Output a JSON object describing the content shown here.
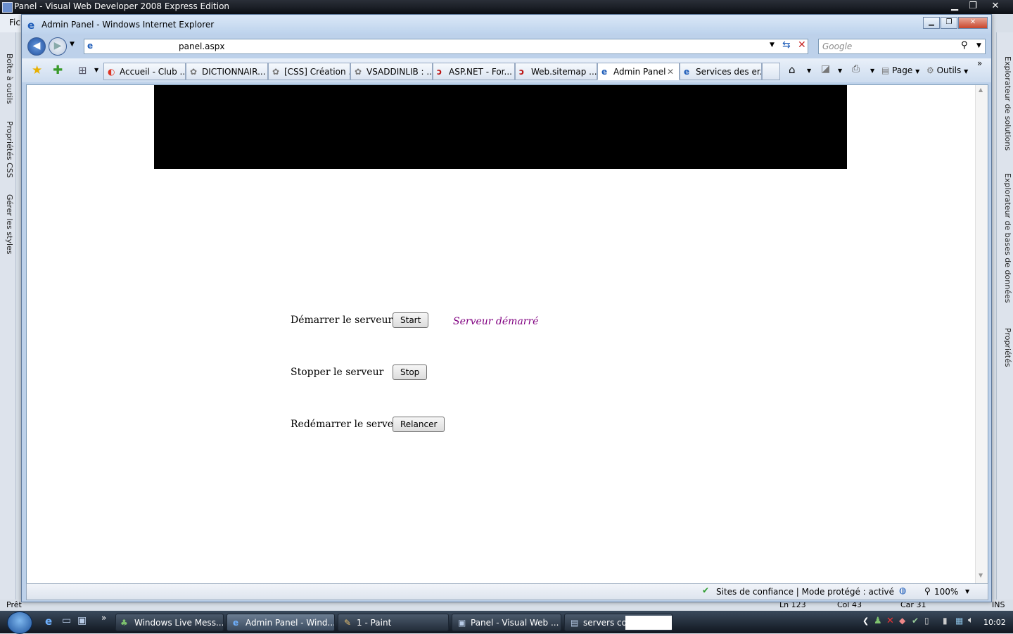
{
  "vs": {
    "title": "Panel - Visual Web Developer 2008 Express Edition",
    "menu_partial": "Fic",
    "left_tabs": [
      "Boîte à outils",
      "Propriétés CSS",
      "Gérer les styles"
    ],
    "right_tabs": [
      "Explorateur de solutions",
      "Explorateur de bases de données",
      "Propriétés"
    ],
    "status": {
      "ready": "Prêt",
      "ln": "Ln 123",
      "col": "Col 43",
      "car": "Car 31",
      "ins": "INS"
    }
  },
  "ie": {
    "title": "Admin Panel - Windows Internet Explorer",
    "address": "panel.aspx",
    "search_placeholder": "Google",
    "tabs": [
      {
        "label": "Accueil - Club ...",
        "active": false
      },
      {
        "label": "DICTIONNAIR...",
        "active": false
      },
      {
        "label": "[CSS] Création ...",
        "active": false
      },
      {
        "label": "VSADDINLIB : ...",
        "active": false
      },
      {
        "label": "ASP.NET - For...",
        "active": false
      },
      {
        "label": "Web.sitemap ...",
        "active": false
      },
      {
        "label": "Admin Panel",
        "active": true
      },
      {
        "label": "Services des er...",
        "active": false
      }
    ],
    "commands": {
      "page": "Page",
      "tools": "Outils"
    },
    "status": {
      "zone": "Sites de confiance | Mode protégé : activé",
      "zoom": "100%"
    }
  },
  "page": {
    "rows": [
      {
        "label": "Démarrer le serveur",
        "button": "Start"
      },
      {
        "label": "Stopper le serveur",
        "button": "Stop"
      },
      {
        "label": "Redémarrer le serveur",
        "button": "Relancer"
      }
    ],
    "server_status": "Serveur démarré",
    "status_color": "#800080"
  },
  "taskbar": {
    "items": [
      {
        "label": "Windows Live Mess...",
        "active": false
      },
      {
        "label": "Admin Panel - Wind...",
        "active": true
      },
      {
        "label": "1 - Paint",
        "active": false
      },
      {
        "label": "Panel - Visual Web ...",
        "active": false
      },
      {
        "label": "servers cod",
        "active": false
      }
    ],
    "clock": "10:02"
  }
}
